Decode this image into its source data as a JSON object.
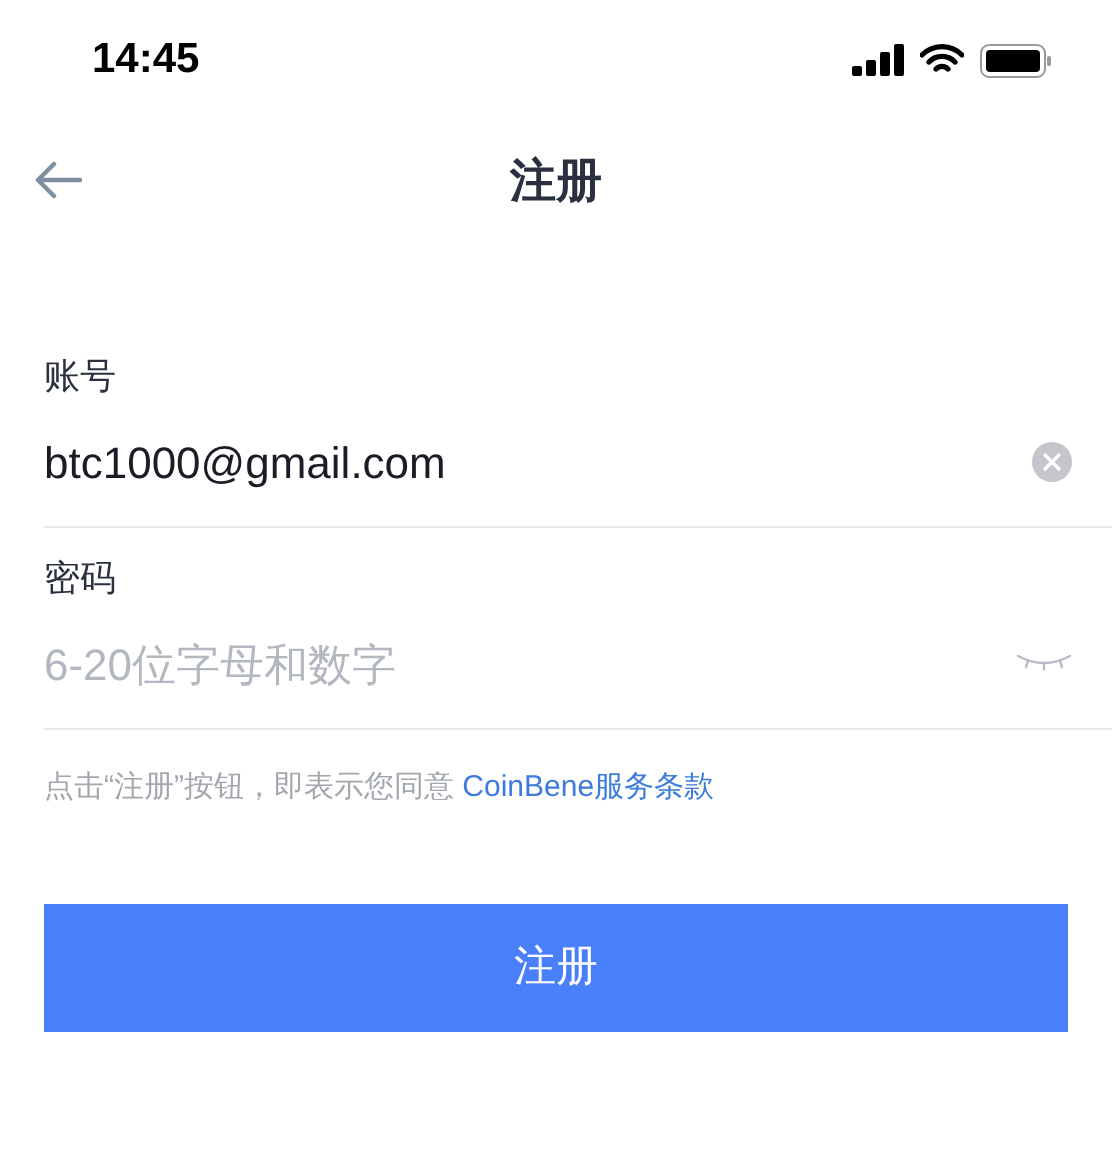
{
  "status_bar": {
    "time": "14:45"
  },
  "nav": {
    "title": "注册"
  },
  "fields": [
    {
      "kind": "text",
      "label": "账号",
      "value": "btc1000@gmail.com"
    },
    {
      "kind": "password",
      "label": "密码",
      "placeholder": "6-20位字母和数字"
    }
  ],
  "terms": {
    "text": "点击“注册”按钮，即表示您同意",
    "link": "CoinBene服务条款"
  },
  "submit": {
    "label": "注册"
  }
}
